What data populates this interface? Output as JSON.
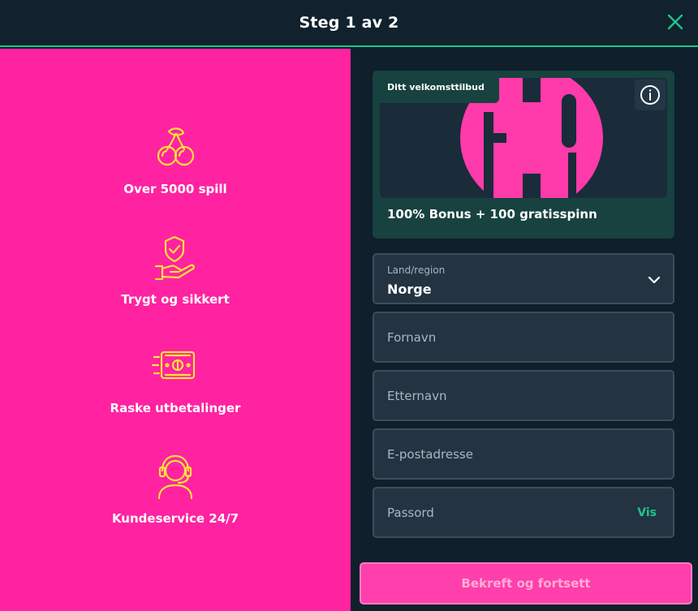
{
  "header": {
    "title": "Steg 1 av 2"
  },
  "features": [
    {
      "label": "Over 5000 spill",
      "icon": "cherries-icon"
    },
    {
      "label": "Trygt og sikkert",
      "icon": "shield-hand-icon"
    },
    {
      "label": "Raske utbetalinger",
      "icon": "money-fast-icon"
    },
    {
      "label": "Kundeservice 24/7",
      "icon": "headset-icon"
    }
  ],
  "promo": {
    "badge": "Ditt velkomsttilbud",
    "offer": "100% Bonus + 100 gratisspinn"
  },
  "form": {
    "country": {
      "label": "Land/region",
      "value": "Norge"
    },
    "first_name": {
      "placeholder": "Fornavn"
    },
    "last_name": {
      "placeholder": "Etternavn"
    },
    "email": {
      "placeholder": "E-postadresse"
    },
    "password": {
      "placeholder": "Passord",
      "show_label": "Vis"
    }
  },
  "submit_label": "Bekreft og fortsett",
  "colors": {
    "brand_pink": "#ff22a1",
    "accent_green": "#1fc58a",
    "icon_yellow": "#ffe23a",
    "dark_bg": "#0f1f2c"
  }
}
